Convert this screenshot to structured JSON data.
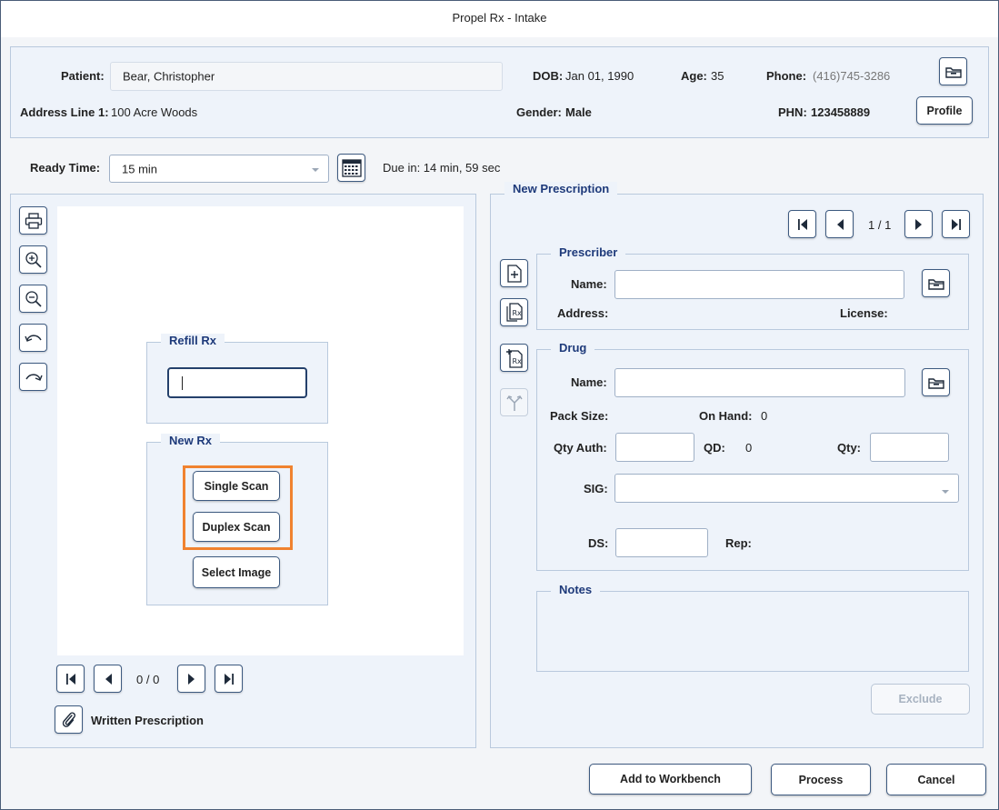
{
  "window": {
    "title": "Propel Rx - Intake"
  },
  "patient": {
    "patient_label": "Patient:",
    "patient_value": "Bear, Christopher",
    "dob_label": "DOB:",
    "dob_value": "Jan 01, 1990",
    "age_label": "Age:",
    "age_value": "35",
    "phone_label": "Phone:",
    "phone_value": "(416)745-3286",
    "address_label": "Address Line 1:",
    "address_value": "100 Acre Woods",
    "gender_label": "Gender:",
    "gender_value": "Male",
    "phn_label": "PHN:",
    "phn_value": "123458889",
    "profile_button": "Profile"
  },
  "ready": {
    "label": "Ready Time:",
    "value": "15 min",
    "due": "Due in: 14 min, 59 sec"
  },
  "scan": {
    "refill_title": "Refill Rx",
    "refill_value": "",
    "newrx_title": "New Rx",
    "single_scan": "Single Scan",
    "duplex_scan": "Duplex Scan",
    "select_image": "Select Image",
    "page_counter": "0 / 0",
    "written_label": "Written Prescription"
  },
  "prescription": {
    "title": "New Prescription",
    "page_counter": "1 / 1",
    "prescriber_title": "Prescriber",
    "prescriber_name_label": "Name:",
    "prescriber_name_value": "",
    "address_label": "Address:",
    "license_label": "License:",
    "drug_title": "Drug",
    "drug_name_label": "Name:",
    "drug_name_value": "",
    "pack_size_label": "Pack Size:",
    "on_hand_label": "On Hand:",
    "on_hand_value": "0",
    "qty_auth_label": "Qty Auth:",
    "qd_label": "QD:",
    "qd_value": "0",
    "qty_label": "Qty:",
    "sig_label": "SIG:",
    "ds_label": "DS:",
    "rep_label": "Rep:",
    "notes_title": "Notes",
    "exclude_button": "Exclude"
  },
  "footer": {
    "add_to_workbench": "Add to Workbench",
    "process": "Process",
    "cancel": "Cancel"
  },
  "colors": {
    "accent": "#3d5a80",
    "highlight": "#f0822f",
    "group_title": "#1e3a7a"
  }
}
